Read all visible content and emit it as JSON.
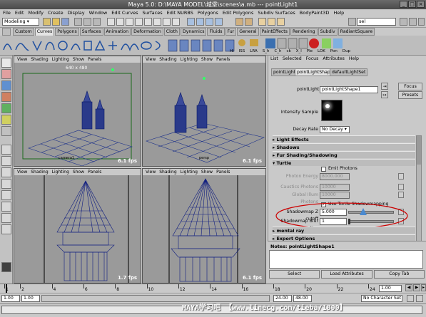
{
  "titlebar": {
    "title": "Maya 5.0: D:\\MAYA MODEL\\城堡\\scenes\\a.mb  ---  pointLight1"
  },
  "menubar": [
    "File",
    "Edit",
    "Modify",
    "Create",
    "Display",
    "Window",
    "Edit Curves",
    "Surfaces",
    "Edit NURBS",
    "Polygons",
    "Edit Polygons",
    "Subdiv Surfaces",
    "BodyPaint3D",
    "Help"
  ],
  "statusline": {
    "mode": "Modeling",
    "sel_field": "sel"
  },
  "shelf_tabs": [
    "Custom",
    "Curves",
    "Polygons",
    "Surfaces",
    "Animation",
    "Deformation",
    "Cloth",
    "Dynamics",
    "Fluids",
    "Fur",
    "General",
    "PaintEffects",
    "Rendering",
    "Subdiv",
    "RadiantSquare"
  ],
  "shelf_labels": [
    "Hi",
    "ISS",
    "LRA",
    "S_h",
    "C_h",
    "ck",
    "X_l",
    "Ple",
    "LOK",
    "Pon",
    "Dup"
  ],
  "viewports": {
    "menu": [
      "View",
      "Shading",
      "Lighting",
      "Show",
      "Panels"
    ],
    "top_left": {
      "label": "640 x 480",
      "camera": "camera1",
      "fps": "6.1 fps"
    },
    "top_right": {
      "camera": "persp",
      "fps": "6.1 fps"
    },
    "bottom_left": {
      "fps": "1.7 fps"
    },
    "bottom_right": {
      "fps": "6.1 fps"
    }
  },
  "attribute_editor": {
    "menu": [
      "List",
      "Selected",
      "Focus",
      "Attributes",
      "Help"
    ],
    "tabs": [
      "pointLight1",
      "pointLightShape1",
      "defaultLightSet"
    ],
    "node_label": "pointLight:",
    "node_value": "pointLightShape1",
    "focus_button": "Focus",
    "presets_button": "Presets",
    "intensity_label": "Intensity Sample",
    "decay_label": "Decay Rate",
    "decay_value": "No Decay",
    "sections": [
      "Light Effects",
      "Shadows",
      "Fur Shading/Shadowing",
      "Turtle"
    ],
    "emit_photons": "Emit Photons",
    "photon_energy": {
      "label": "Photon Energy",
      "value": "8000.000"
    },
    "caustics_photons": {
      "label": "Caustics Photons",
      "value": "10000"
    },
    "global_illum_photons": {
      "label": "Global Illum Photons",
      "value": "10000"
    },
    "use_turtle_shadowmapping": "Use Turtle Shadowmapping",
    "shadowmap_z_cutoff": {
      "label": "Shadowmap Z cutoff",
      "value": "5.000",
      "fraction": 0.33
    },
    "shadowmap_blur_size": {
      "label": "Shadowmap Blur Size",
      "value": "1",
      "fraction": 0.0
    },
    "mental_ray": "mental ray",
    "export_options": "Export Options",
    "notes_label": "Notes: pointLightShape1",
    "buttons": [
      "Select",
      "Load Attributes",
      "Copy Tab"
    ]
  },
  "timeline": {
    "ticks": [
      "1",
      "2",
      "4",
      "6",
      "8",
      "10",
      "12",
      "14",
      "16",
      "18",
      "20",
      "22",
      "24"
    ],
    "current_frame": "1.00"
  },
  "rangebar": {
    "start": "1.00",
    "playback_start": "1.00",
    "playback_end": "24.00",
    "end": "48.00",
    "character_set": "No Character Set",
    "time_field": "1.00"
  },
  "watermark": "MAYA学习吧 【www.linecg.com/tieba/1800】",
  "colors": {
    "highlight_ellipse": "#cc0000",
    "active_light": "#33ff66"
  }
}
